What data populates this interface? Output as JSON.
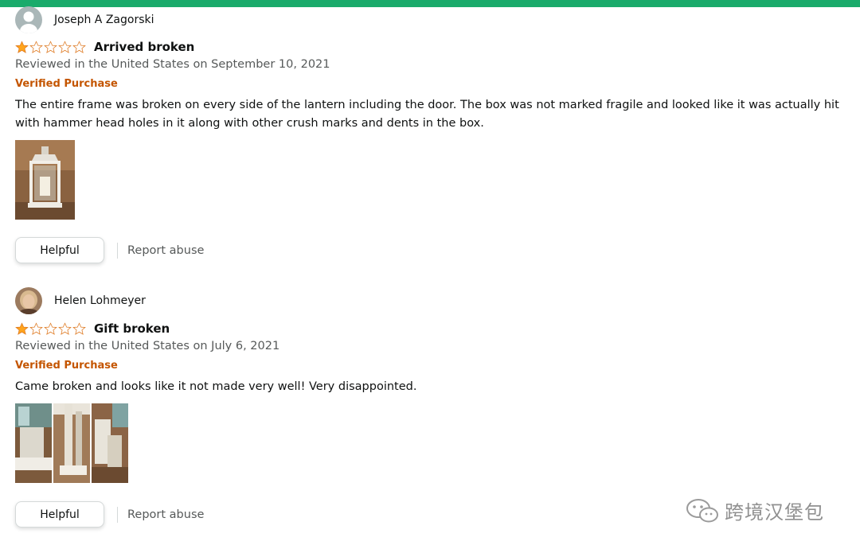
{
  "reviews": [
    {
      "reviewer": "Joseph A Zagorski",
      "rating": 1,
      "rating_max": 5,
      "title": "Arrived broken",
      "date": "Reviewed in the United States on September 10, 2021",
      "verified": "Verified Purchase",
      "body": "The entire frame was broken on every side of the lantern including the door. The box was not marked fragile and looked like it was actually hit with hammer head holes in it along with other crush marks and dents in the box.",
      "photo_count": 1,
      "helpful_label": "Helpful",
      "report_label": "Report abuse"
    },
    {
      "reviewer": "Helen Lohmeyer",
      "rating": 1,
      "rating_max": 5,
      "title": "Gift broken",
      "date": "Reviewed in the United States on July 6, 2021",
      "verified": "Verified Purchase",
      "body": "Came broken and looks like it not made very well! Very disappointed.",
      "photo_count": 3,
      "helpful_label": "Helpful",
      "report_label": "Report abuse"
    }
  ],
  "watermark": {
    "text": "跨境汉堡包",
    "icon": "wechat-icon"
  },
  "colors": {
    "star_fill": "#ffa41c",
    "star_outline": "#de7921",
    "verified": "#c45500",
    "top_bar": "#1aab6b"
  }
}
